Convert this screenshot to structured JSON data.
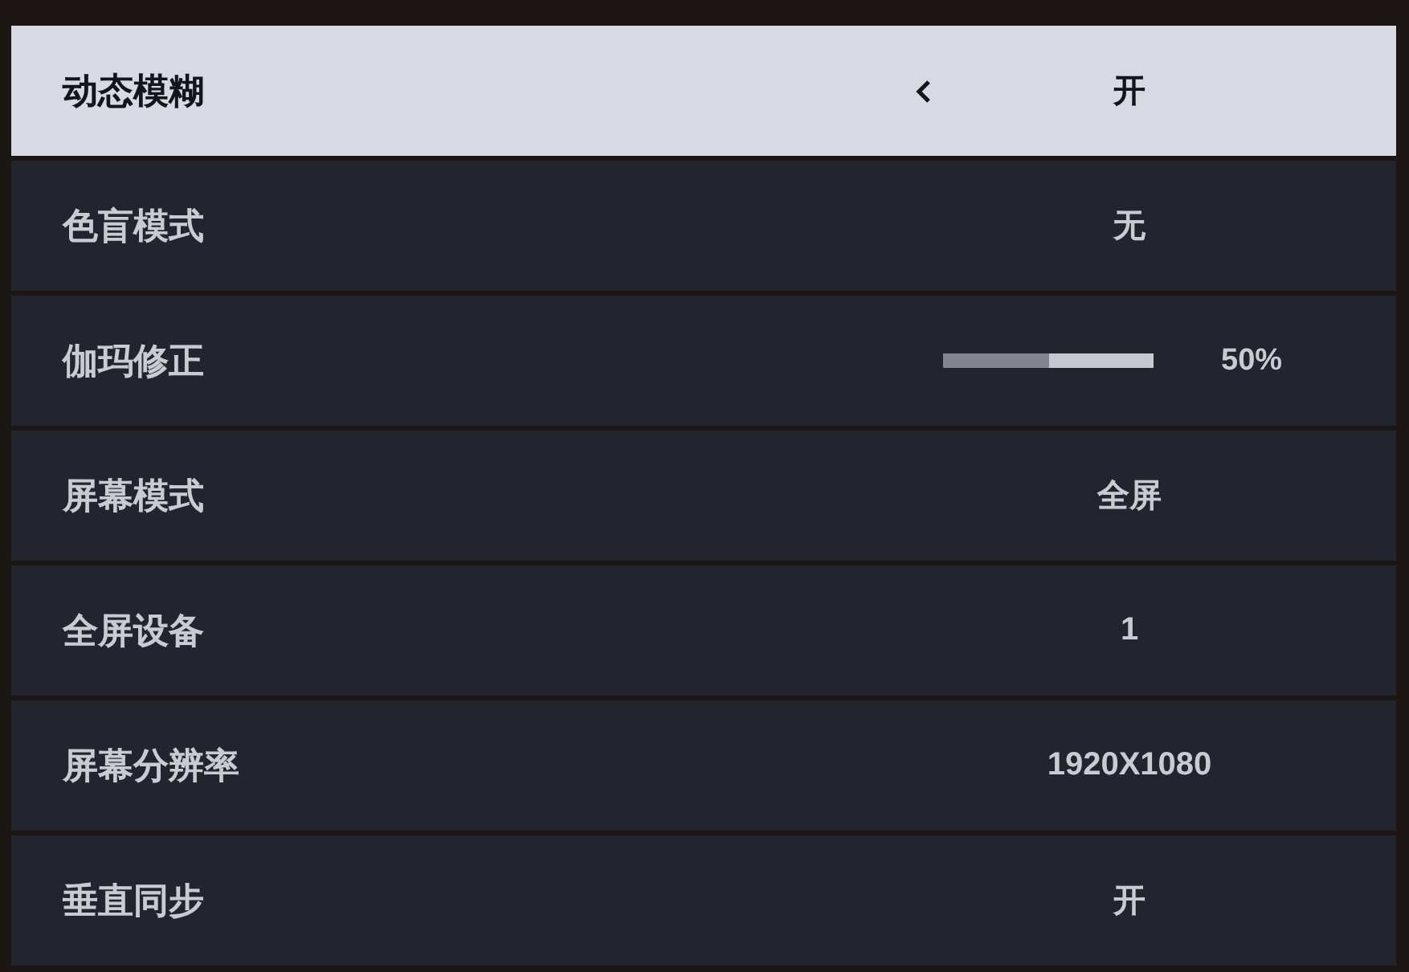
{
  "settings": [
    {
      "kind": "option",
      "label": "动态模糊",
      "value": "开",
      "selected": true
    },
    {
      "kind": "option",
      "label": "色盲模式",
      "value": "无",
      "selected": false
    },
    {
      "kind": "slider",
      "label": "伽玛修正",
      "level": 0.5,
      "reading": "50%",
      "selected": false
    },
    {
      "kind": "option",
      "label": "屏幕模式",
      "value": "全屏",
      "selected": false
    },
    {
      "kind": "option",
      "label": "全屏设备",
      "value": "1",
      "selected": false
    },
    {
      "kind": "option",
      "label": "屏幕分辨率",
      "value": "1920X1080",
      "selected": false
    },
    {
      "kind": "option",
      "label": "垂直同步",
      "value": "开",
      "selected": false
    }
  ]
}
